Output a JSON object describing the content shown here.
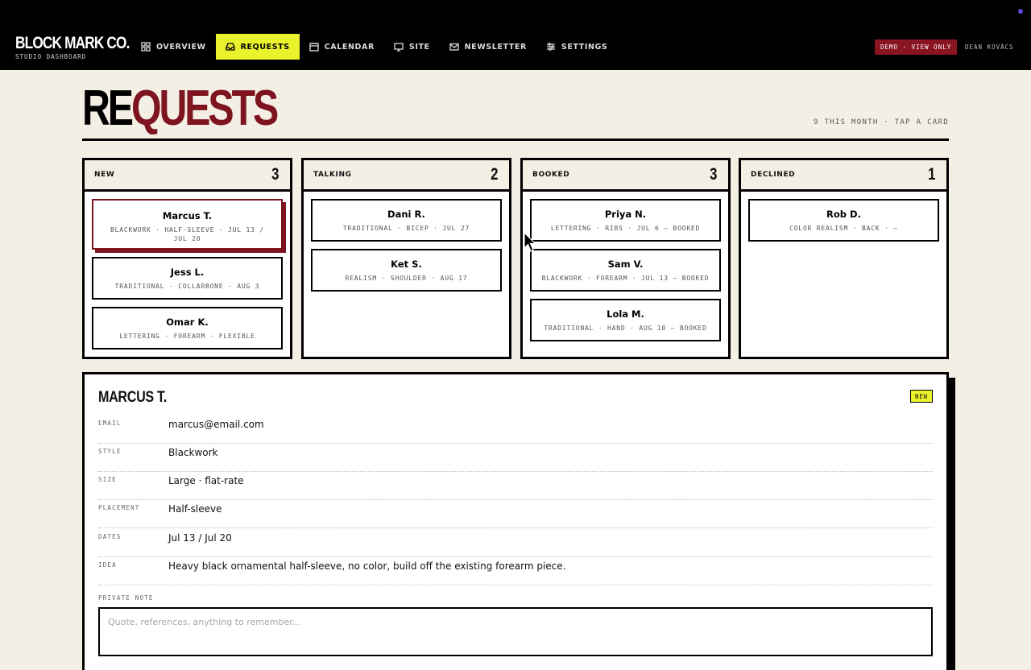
{
  "brand": {
    "name": "BLOCK MARK CO.",
    "subtitle": "STUDIO DASHBOARD"
  },
  "nav": [
    {
      "label": "OVERVIEW",
      "icon": "grid-icon",
      "active": false
    },
    {
      "label": "REQUESTS",
      "icon": "inbox-icon",
      "active": true
    },
    {
      "label": "CALENDAR",
      "icon": "calendar-icon",
      "active": false
    },
    {
      "label": "SITE",
      "icon": "monitor-icon",
      "active": false
    },
    {
      "label": "NEWSLETTER",
      "icon": "mail-icon",
      "active": false
    },
    {
      "label": "SETTINGS",
      "icon": "sliders-icon",
      "active": false
    }
  ],
  "header_right": {
    "demo_badge": "DEMO · VIEW ONLY",
    "user": "DEAN KOVÁCS"
  },
  "page": {
    "title_part1": "RE",
    "title_part2": "QUESTS",
    "meta": "9 THIS MONTH · TAP A CARD"
  },
  "board": {
    "columns": [
      {
        "title": "NEW",
        "count": "3",
        "cards": [
          {
            "name": "Marcus T.",
            "meta": "BLACKWORK · HALF-SLEEVE · JUL 13 / JUL 20",
            "selected": true
          },
          {
            "name": "Jess L.",
            "meta": "TRADITIONAL · COLLARBONE · AUG 3"
          },
          {
            "name": "Omar K.",
            "meta": "LETTERING · FOREARM · FLEXIBLE"
          }
        ]
      },
      {
        "title": "TALKING",
        "count": "2",
        "cards": [
          {
            "name": "Dani R.",
            "meta": "TRADITIONAL · BICEP · JUL 27"
          },
          {
            "name": "Ket S.",
            "meta": "REALISM · SHOULDER · AUG 17"
          }
        ]
      },
      {
        "title": "BOOKED",
        "count": "3",
        "cards": [
          {
            "name": "Priya N.",
            "meta": "LETTERING · RIBS · JUL 6 — BOOKED"
          },
          {
            "name": "Sam V.",
            "meta": "BLACKWORK · FOREARM · JUL 13 — BOOKED"
          },
          {
            "name": "Lola M.",
            "meta": "TRADITIONAL · HAND · AUG 10 — BOOKED"
          }
        ]
      },
      {
        "title": "DECLINED",
        "count": "1",
        "cards": [
          {
            "name": "Rob D.",
            "meta": "COLOR REALISM · BACK · —"
          }
        ]
      }
    ]
  },
  "detail": {
    "name": "MARCUS T.",
    "badge": "NEW",
    "fields": [
      {
        "label": "EMAIL",
        "value": "marcus@email.com"
      },
      {
        "label": "STYLE",
        "value": "Blackwork"
      },
      {
        "label": "SIZE",
        "value": "Large · flat-rate"
      },
      {
        "label": "PLACEMENT",
        "value": "Half-sleeve"
      },
      {
        "label": "DATES",
        "value": "Jul 13 / Jul 20"
      },
      {
        "label": "IDEA",
        "value": "Heavy black ornamental half-sleeve, no color, build off the existing forearm piece."
      }
    ],
    "note_label": "PRIVATE NOTE",
    "note_placeholder": "Quote, references, anything to remember...",
    "note_value": ""
  },
  "colors": {
    "accent_yellow": "#e9f22b",
    "accent_red": "#7d1420",
    "badge_red": "#8a1522",
    "background": "#f4efe5"
  }
}
